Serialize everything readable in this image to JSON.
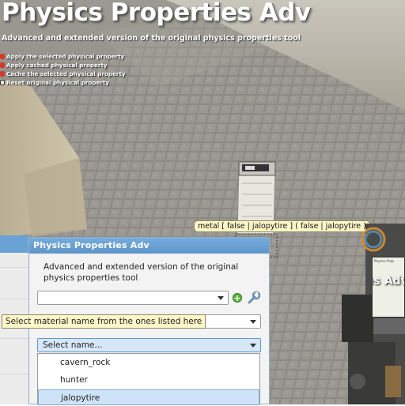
{
  "hud": {
    "title": "Physics Properties Adv",
    "subtitle": "Advanced and extended version of the original physics properties tool",
    "keys": [
      {
        "icon": "mouse-left-icon",
        "color": "#d23a2a",
        "label": "Apply the selected physical property"
      },
      {
        "icon": "mouse-right-icon",
        "color": "#d23a2a",
        "label": "Apply cached physical property"
      },
      {
        "icon": "mouse-left-icon",
        "color": "#d23a2a",
        "label": "Cache the selected physical property"
      },
      {
        "icon": "reload-key-icon",
        "color": "#e8e8e8",
        "label": "Reset original physical property"
      }
    ]
  },
  "entity_label": "metal [ false | jalopytire ] ( false | jalopytire )",
  "panel": {
    "header": "Physics Properties Adv",
    "description": "Advanced and extended version of the original physics properties tool",
    "combo_top": {
      "value": ""
    },
    "combo_mid": {
      "value": ""
    },
    "combo_name": {
      "value": "Select name..."
    }
  },
  "tooltip": "Select material name from the ones listed here",
  "dropdown": {
    "items": [
      "cavern_rock",
      "hunter",
      "jalopytire"
    ],
    "selected": "jalopytire"
  },
  "toolgun_screen": {
    "title": "es Adv",
    "small": "Physics Prop"
  },
  "colors": {
    "panel_header": "#5d95c9",
    "tooltip_bg": "#fff7c8",
    "selected_item": "#cfe3f8"
  }
}
